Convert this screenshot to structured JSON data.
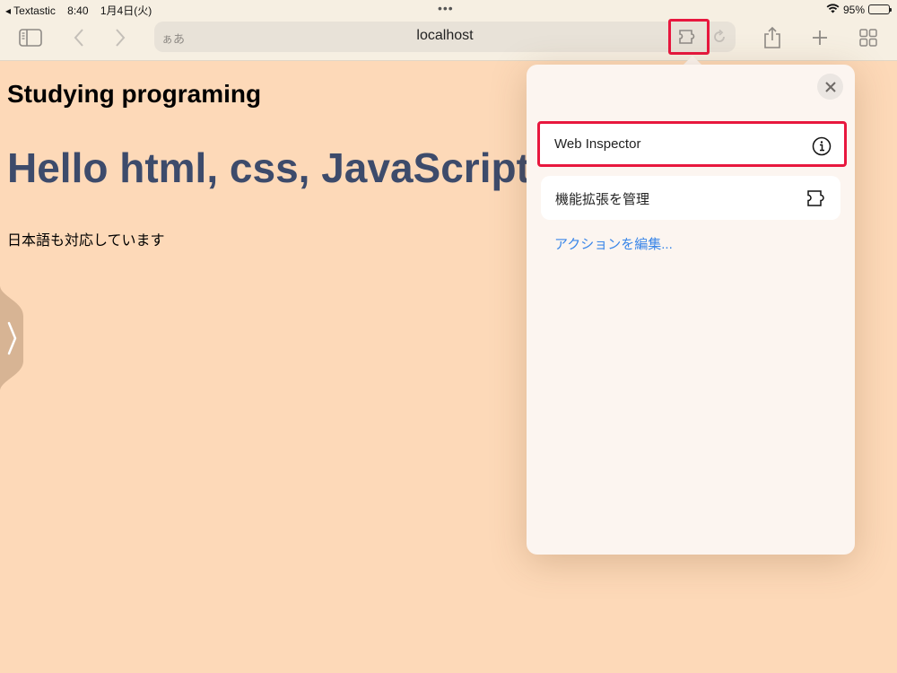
{
  "status_bar": {
    "back_app": "◂ Textastic",
    "time": "8:40",
    "date": "1月4日(火)",
    "multitask_dots": "•••",
    "battery_pct": "95%",
    "battery_level": 0.95
  },
  "toolbar": {
    "address_aa": "ぁあ",
    "url": "localhost"
  },
  "page": {
    "heading": "Studying programing",
    "title": "Hello html, css, JavaScript",
    "paragraph": "日本語も対応しています"
  },
  "popover": {
    "items": [
      {
        "label": "Web Inspector",
        "icon": "info-icon"
      },
      {
        "label": "機能拡張を管理",
        "icon": "puzzle-icon"
      }
    ],
    "edit_actions": "アクションを編集..."
  },
  "colors": {
    "page_bg": "#fdd9b8",
    "highlight": "#e8173e",
    "link": "#3a86e8",
    "title_text": "#3d4b6b"
  }
}
